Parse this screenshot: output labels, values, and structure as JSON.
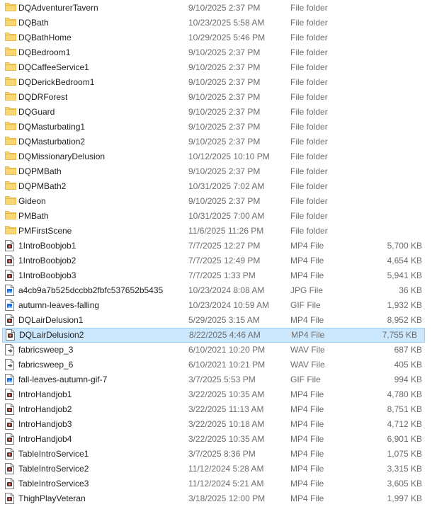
{
  "colors": {
    "folder": "#f8d775",
    "folder_dark": "#e8b84a",
    "video_icon": "#c0392b",
    "image_icon": "#1e6fd9",
    "audio_icon": "#2b2b2b",
    "selection_bg": "#cce8ff",
    "selection_border": "#99d1ff"
  },
  "files": [
    {
      "name": "DQAdventurerTavern",
      "date": "9/10/2025 2:37 PM",
      "type": "File folder",
      "size": "",
      "icon": "folder-icon"
    },
    {
      "name": "DQBath",
      "date": "10/23/2025 5:58 AM",
      "type": "File folder",
      "size": "",
      "icon": "folder-icon"
    },
    {
      "name": "DQBathHome",
      "date": "10/29/2025 5:46 PM",
      "type": "File folder",
      "size": "",
      "icon": "folder-icon"
    },
    {
      "name": "DQBedroom1",
      "date": "9/10/2025 2:37 PM",
      "type": "File folder",
      "size": "",
      "icon": "folder-icon"
    },
    {
      "name": "DQCaffeeService1",
      "date": "9/10/2025 2:37 PM",
      "type": "File folder",
      "size": "",
      "icon": "folder-icon"
    },
    {
      "name": "DQDerickBedroom1",
      "date": "9/10/2025 2:37 PM",
      "type": "File folder",
      "size": "",
      "icon": "folder-icon"
    },
    {
      "name": "DQDRForest",
      "date": "9/10/2025 2:37 PM",
      "type": "File folder",
      "size": "",
      "icon": "folder-icon"
    },
    {
      "name": "DQGuard",
      "date": "9/10/2025 2:37 PM",
      "type": "File folder",
      "size": "",
      "icon": "folder-icon"
    },
    {
      "name": "DQMasturbating1",
      "date": "9/10/2025 2:37 PM",
      "type": "File folder",
      "size": "",
      "icon": "folder-icon"
    },
    {
      "name": "DQMasturbation2",
      "date": "9/10/2025 2:37 PM",
      "type": "File folder",
      "size": "",
      "icon": "folder-icon"
    },
    {
      "name": "DQMissionaryDelusion",
      "date": "10/12/2025 10:10 PM",
      "type": "File folder",
      "size": "",
      "icon": "folder-icon"
    },
    {
      "name": "DQPMBath",
      "date": "9/10/2025 2:37 PM",
      "type": "File folder",
      "size": "",
      "icon": "folder-icon"
    },
    {
      "name": "DQPMBath2",
      "date": "10/31/2025 7:02 AM",
      "type": "File folder",
      "size": "",
      "icon": "folder-icon"
    },
    {
      "name": "Gideon",
      "date": "9/10/2025 2:37 PM",
      "type": "File folder",
      "size": "",
      "icon": "folder-icon"
    },
    {
      "name": "PMBath",
      "date": "10/31/2025 7:00 AM",
      "type": "File folder",
      "size": "",
      "icon": "folder-icon"
    },
    {
      "name": "PMFirstScene",
      "date": "11/6/2025 11:26 PM",
      "type": "File folder",
      "size": "",
      "icon": "folder-icon"
    },
    {
      "name": "1IntroBoobjob1",
      "date": "7/7/2025 12:27 PM",
      "type": "MP4 File",
      "size": "5,700 KB",
      "icon": "video-file-icon"
    },
    {
      "name": "1IntroBoobjob2",
      "date": "7/7/2025 12:49 PM",
      "type": "MP4 File",
      "size": "4,654 KB",
      "icon": "video-file-icon"
    },
    {
      "name": "1IntroBoobjob3",
      "date": "7/7/2025 1:33 PM",
      "type": "MP4 File",
      "size": "5,941 KB",
      "icon": "video-file-icon"
    },
    {
      "name": "a4cb9a7b525dccbb2fbfc537652b5435",
      "date": "10/23/2024 8:08 AM",
      "type": "JPG File",
      "size": "36 KB",
      "icon": "image-file-icon"
    },
    {
      "name": "autumn-leaves-falling",
      "date": "10/23/2024 10:59 AM",
      "type": "GIF File",
      "size": "1,932 KB",
      "icon": "image-file-icon"
    },
    {
      "name": "DQLairDelusion1",
      "date": "5/29/2025 3:15 AM",
      "type": "MP4 File",
      "size": "8,952 KB",
      "icon": "video-file-icon"
    },
    {
      "name": "DQLairDelusion2",
      "date": "8/22/2025 4:46 AM",
      "type": "MP4 File",
      "size": "7,755 KB",
      "icon": "video-file-icon",
      "selected": true
    },
    {
      "name": "fabricsweep_3",
      "date": "6/10/2021 10:20 PM",
      "type": "WAV File",
      "size": "687 KB",
      "icon": "audio-file-icon"
    },
    {
      "name": "fabricsweep_6",
      "date": "6/10/2021 10:21 PM",
      "type": "WAV File",
      "size": "405 KB",
      "icon": "audio-file-icon"
    },
    {
      "name": "fall-leaves-autumn-gif-7",
      "date": "3/7/2025 5:53 PM",
      "type": "GIF File",
      "size": "994 KB",
      "icon": "image-file-icon"
    },
    {
      "name": "IntroHandjob1",
      "date": "3/22/2025 10:35 AM",
      "type": "MP4 File",
      "size": "4,780 KB",
      "icon": "video-file-icon"
    },
    {
      "name": "IntroHandjob2",
      "date": "3/22/2025 11:13 AM",
      "type": "MP4 File",
      "size": "8,751 KB",
      "icon": "video-file-icon"
    },
    {
      "name": "IntroHandjob3",
      "date": "3/22/2025 10:18 AM",
      "type": "MP4 File",
      "size": "4,712 KB",
      "icon": "video-file-icon"
    },
    {
      "name": "IntroHandjob4",
      "date": "3/22/2025 10:35 AM",
      "type": "MP4 File",
      "size": "6,901 KB",
      "icon": "video-file-icon"
    },
    {
      "name": "TableIntroService1",
      "date": "3/7/2025 8:36 PM",
      "type": "MP4 File",
      "size": "1,075 KB",
      "icon": "video-file-icon"
    },
    {
      "name": "TableIntroService2",
      "date": "11/12/2024 5:28 AM",
      "type": "MP4 File",
      "size": "3,315 KB",
      "icon": "video-file-icon"
    },
    {
      "name": "TableIntroService3",
      "date": "11/12/2024 5:21 AM",
      "type": "MP4 File",
      "size": "3,605 KB",
      "icon": "video-file-icon"
    },
    {
      "name": "ThighPlayVeteran",
      "date": "3/18/2025 12:00 PM",
      "type": "MP4 File",
      "size": "1,997 KB",
      "icon": "video-file-icon"
    }
  ]
}
